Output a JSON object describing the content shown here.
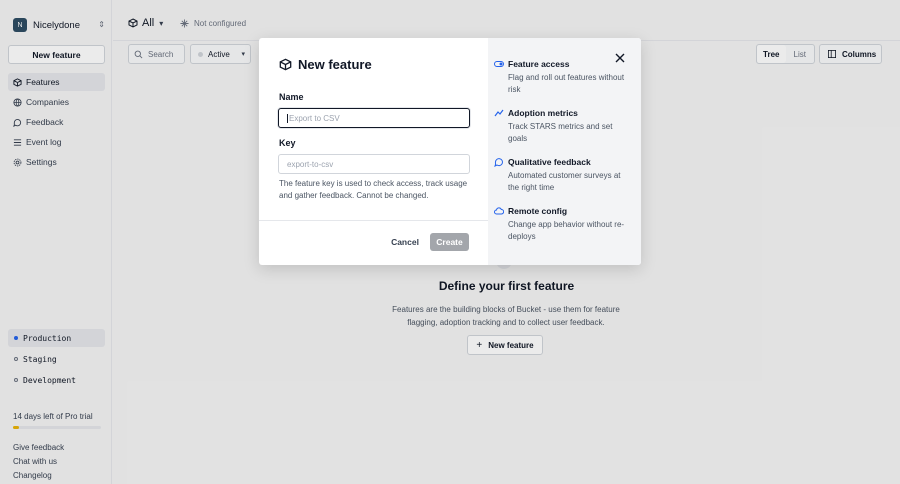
{
  "sidebar": {
    "org_initial": "N",
    "org_name": "Nicelydone",
    "new_feature_label": "New feature",
    "nav": [
      {
        "label": "Features",
        "icon": "features-icon",
        "active": true
      },
      {
        "label": "Companies",
        "icon": "companies-icon"
      },
      {
        "label": "Feedback",
        "icon": "feedback-icon"
      },
      {
        "label": "Event log",
        "icon": "event-log-icon"
      },
      {
        "label": "Settings",
        "icon": "settings-icon"
      }
    ],
    "environments": [
      {
        "label": "Production",
        "active": true
      },
      {
        "label": "Staging"
      },
      {
        "label": "Development"
      }
    ],
    "trial_text": "14 days left of Pro trial",
    "trial_progress": 0.07,
    "links": [
      "Give feedback",
      "Chat with us",
      "Changelog"
    ]
  },
  "topbar": {
    "scope_label": "All",
    "status_label": "Not configured"
  },
  "toolbar": {
    "search_placeholder": "Search",
    "filter_label": "Active",
    "view_tree": "Tree",
    "view_list": "List",
    "columns_label": "Columns"
  },
  "empty_state": {
    "title": "Define your first feature",
    "description": "Features are the building blocks of Bucket - use them for feature flagging, adoption tracking and to collect user feedback.",
    "button_label": "New feature"
  },
  "modal": {
    "title": "New feature",
    "name_label": "Name",
    "name_placeholder": "Export to CSV",
    "key_label": "Key",
    "key_placeholder": "export-to-csv",
    "hint": "The feature key is used to check access, track usage and gather feedback. Cannot be changed.",
    "cancel_label": "Cancel",
    "create_label": "Create",
    "benefits": [
      {
        "title": "Feature access",
        "description": "Flag and roll out features without risk"
      },
      {
        "title": "Adoption metrics",
        "description": "Track STARS metrics and set goals"
      },
      {
        "title": "Qualitative feedback",
        "description": "Automated customer surveys at the right time"
      },
      {
        "title": "Remote config",
        "description": "Change app behavior without re-deploys"
      }
    ]
  },
  "colors": {
    "accent_blue": "#2563eb",
    "trial_bar": "#eab308",
    "avatar_bg": "#2e4c63",
    "create_disabled": "#a3a6ab"
  }
}
